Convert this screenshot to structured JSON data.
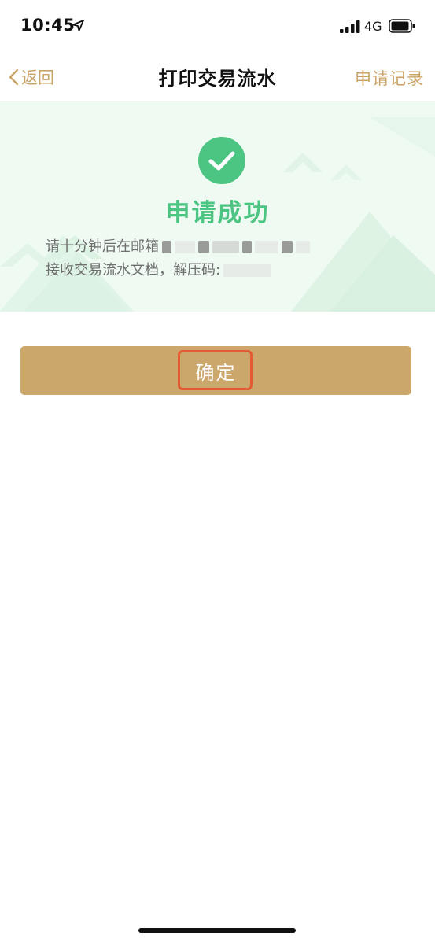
{
  "status_bar": {
    "time": "10:45",
    "network": "4G"
  },
  "nav": {
    "back_label": "返回",
    "title": "打印交易流水",
    "records_label": "申请记录"
  },
  "success": {
    "title": "申请成功",
    "message_line1": "请十分钟后在邮箱",
    "message_line2": "接收交易流水文档，解压码:"
  },
  "confirm": {
    "label": "确定"
  },
  "colors": {
    "accent_gold": "#c9a366",
    "button_gold": "#cca76c",
    "success_green": "#4cc482",
    "banner_bg": "#eefaf2",
    "highlight_red": "#e45a32"
  },
  "icons": {
    "location": "location-arrow-icon",
    "signal": "cellular-signal-icon",
    "battery": "battery-icon",
    "back": "chevron-left-icon",
    "success": "check-circle-icon"
  }
}
